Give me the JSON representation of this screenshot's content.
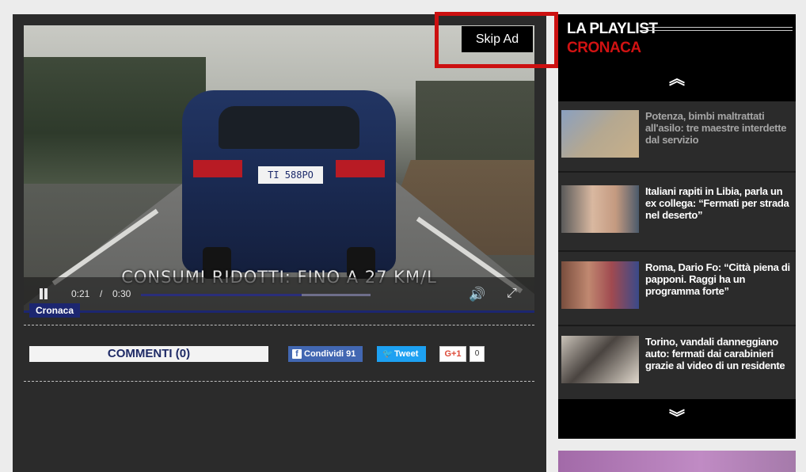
{
  "video": {
    "caption": "CONSUMI RIDOTTI: FINO A 27 KM/L",
    "plate": "TI 588PO",
    "current_time": "0:21",
    "separator": "/",
    "total_time": "0:30",
    "progress_percent": 70,
    "category_badge": "Cronaca",
    "skip_ad_label": "Skip Ad"
  },
  "social": {
    "comments_label": "COMMENTI (0)",
    "facebook_label": "Condividi 91",
    "facebook_icon": "f",
    "twitter_label": "Tweet",
    "twitter_icon": "🐦",
    "gplus_label": "G+1",
    "gplus_count": "0"
  },
  "playlist": {
    "title": "LA PLAYLIST",
    "category": "CRONACA",
    "up_icon": "︽",
    "down_icon": "︾",
    "items": [
      {
        "title": "Potenza, bimbi maltrattati all'asilo: tre maestre interdette dal servizio",
        "dimmed": true
      },
      {
        "title": "Italiani rapiti in Libia, parla un ex collega: “Fermati per strada nel deserto”"
      },
      {
        "title": "Roma, Dario Fo: “Città piena di papponi. Raggi ha un programma forte”"
      },
      {
        "title": "Torino, vandali danneggiano auto: fermati dai carabinieri grazie al video di un residente"
      }
    ]
  },
  "colors": {
    "accent_red": "#cc1010",
    "category_blue": "#1c2670",
    "panel_dark": "#2b2b2b"
  }
}
